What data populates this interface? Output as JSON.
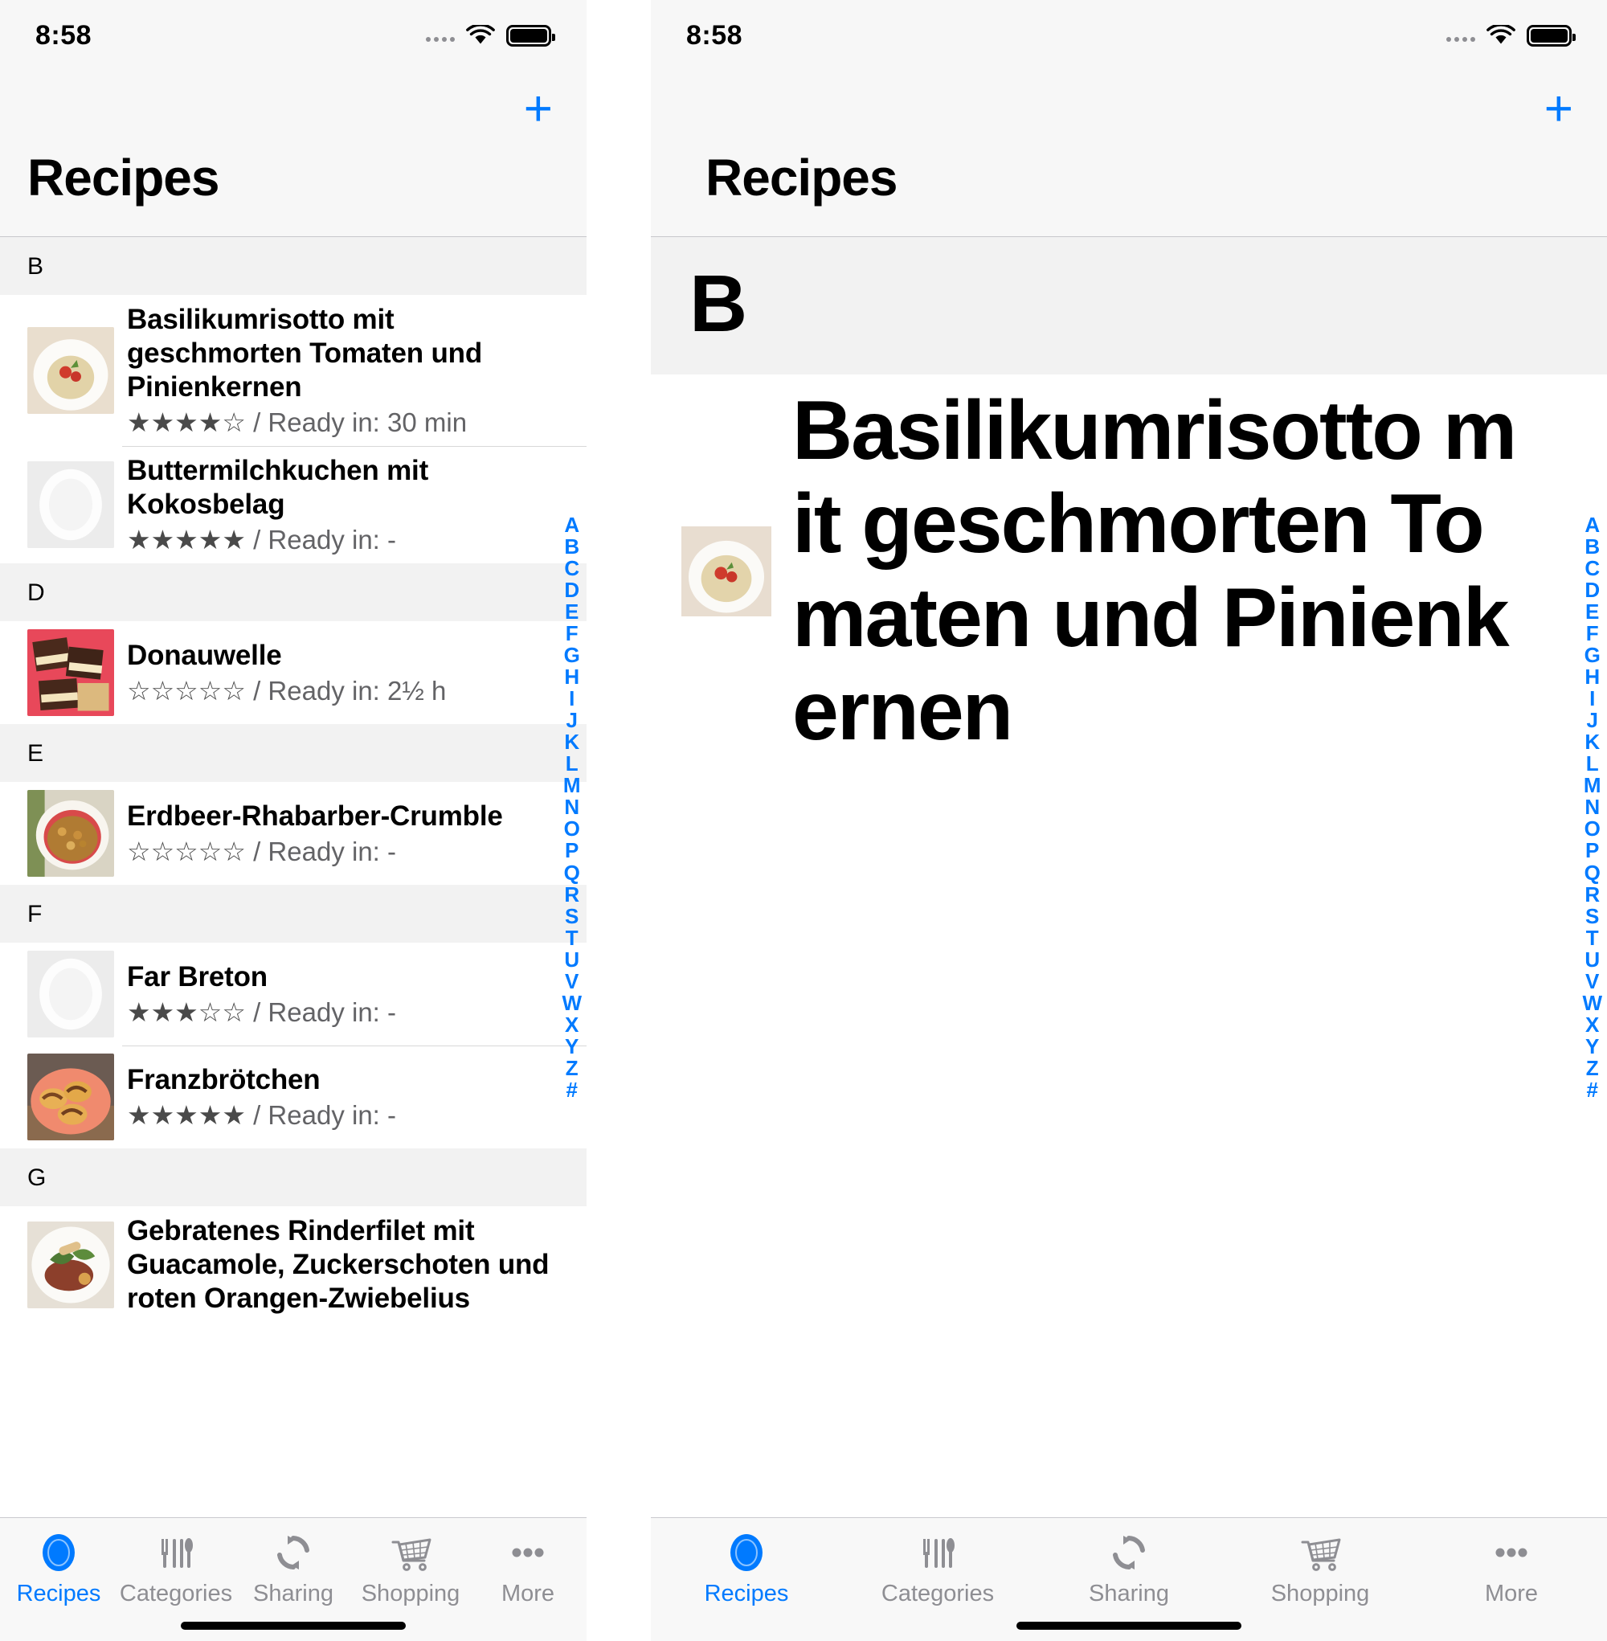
{
  "status_bar": {
    "time": "8:58"
  },
  "nav": {
    "add_label": "+",
    "title": "Recipes"
  },
  "index_bar": {
    "letters": [
      "A",
      "B",
      "C",
      "D",
      "E",
      "F",
      "G",
      "H",
      "I",
      "J",
      "K",
      "L",
      "M",
      "N",
      "O",
      "P",
      "Q",
      "R",
      "S",
      "T",
      "U",
      "V",
      "W",
      "X",
      "Y",
      "Z",
      "#"
    ]
  },
  "meta_separator": " / ",
  "ready_prefix": "Ready in: ",
  "left_panel": {
    "sections": [
      {
        "letter": "B",
        "recipes": [
          {
            "title": "Basilikumrisotto mit geschmorten Tomaten und Pinienkernen",
            "stars": "★★★★☆",
            "rating": 4,
            "ready_in": "30 min",
            "meta": "★★★★☆ / Ready in: 30 min",
            "thumb": "risotto-plate-photo"
          },
          {
            "title": "Buttermilchkuchen mit Kokosbelag",
            "stars": "★★★★★",
            "rating": 5,
            "ready_in": "-",
            "meta": "★★★★★ / Ready in: -",
            "thumb": "empty-plate-placeholder"
          }
        ]
      },
      {
        "letter": "D",
        "recipes": [
          {
            "title": "Donauwelle",
            "stars": "☆☆☆☆☆",
            "rating": 0,
            "ready_in": "2½ h",
            "meta": "☆☆☆☆☆ / Ready in: 2½ h",
            "thumb": "donauwelle-cake-photo"
          }
        ]
      },
      {
        "letter": "E",
        "recipes": [
          {
            "title": "Erdbeer-Rhabarber-Crumble",
            "stars": "☆☆☆☆☆",
            "rating": 0,
            "ready_in": "-",
            "meta": "☆☆☆☆☆ / Ready in: -",
            "thumb": "crumble-bowl-photo"
          }
        ]
      },
      {
        "letter": "F",
        "recipes": [
          {
            "title": "Far Breton",
            "stars": "★★★☆☆",
            "rating": 3,
            "ready_in": "-",
            "meta": "★★★☆☆ / Ready in: -",
            "thumb": "empty-plate-placeholder"
          },
          {
            "title": "Franzbrötchen",
            "stars": "★★★★★",
            "rating": 5,
            "ready_in": "-",
            "meta": "★★★★★ / Ready in: -",
            "thumb": "franzbroetchen-plate-photo"
          }
        ]
      },
      {
        "letter": "G",
        "recipes": [
          {
            "title": "Gebratenes Rinderfilet mit Guacamole, Zuckerschoten und roten Orangen-Zwiebelius",
            "stars": "",
            "rating": null,
            "ready_in": "",
            "meta": "",
            "thumb": "rinderfilet-plate-photo"
          }
        ]
      }
    ]
  },
  "right_panel": {
    "section_letter": "B",
    "recipe_title": "Basilikumrisotto mit geschmorten Tomaten und Pinienkernen",
    "thumb": "risotto-plate-photo"
  },
  "tab_bar": {
    "tabs": [
      {
        "label": "Recipes",
        "icon": "plate-icon",
        "active": true
      },
      {
        "label": "Categories",
        "icon": "cutlery-icon",
        "active": false
      },
      {
        "label": "Sharing",
        "icon": "sync-arrows-icon",
        "active": false
      },
      {
        "label": "Shopping",
        "icon": "shopping-cart-icon",
        "active": false
      },
      {
        "label": "More",
        "icon": "ellipsis-icon",
        "active": false
      }
    ]
  },
  "colors": {
    "accent": "#007aff",
    "inactive": "#8e8e93",
    "section_bg": "#f2f2f2",
    "bar_bg": "#f7f7f7"
  }
}
